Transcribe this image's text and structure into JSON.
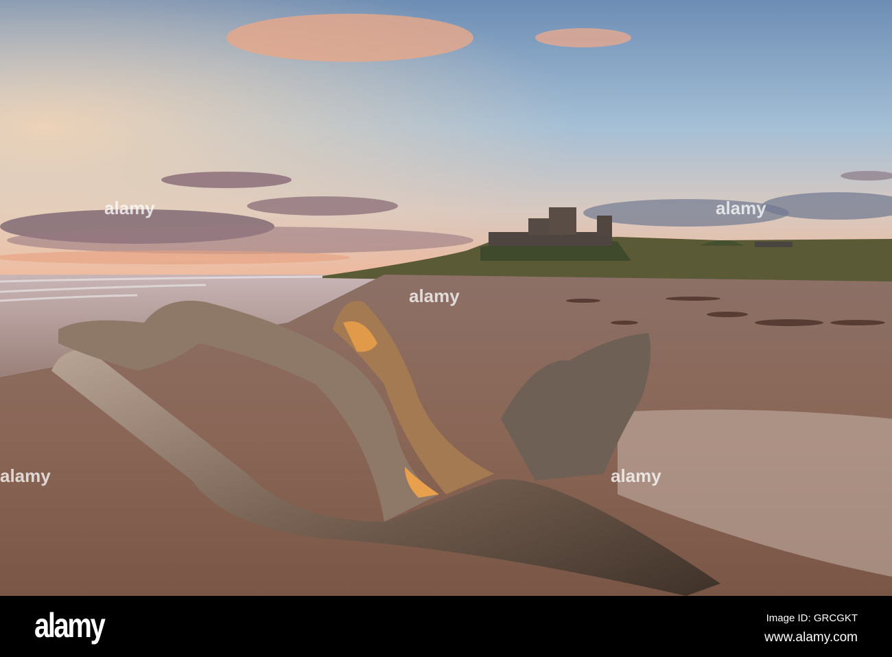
{
  "photo": {
    "subject": "Driftwood on beach with castle at sunset"
  },
  "footer": {
    "logo": "alamy",
    "image_id": "Image ID: GRCGKT",
    "site": "www.alamy.com"
  },
  "watermark": {
    "text": "alamy"
  }
}
